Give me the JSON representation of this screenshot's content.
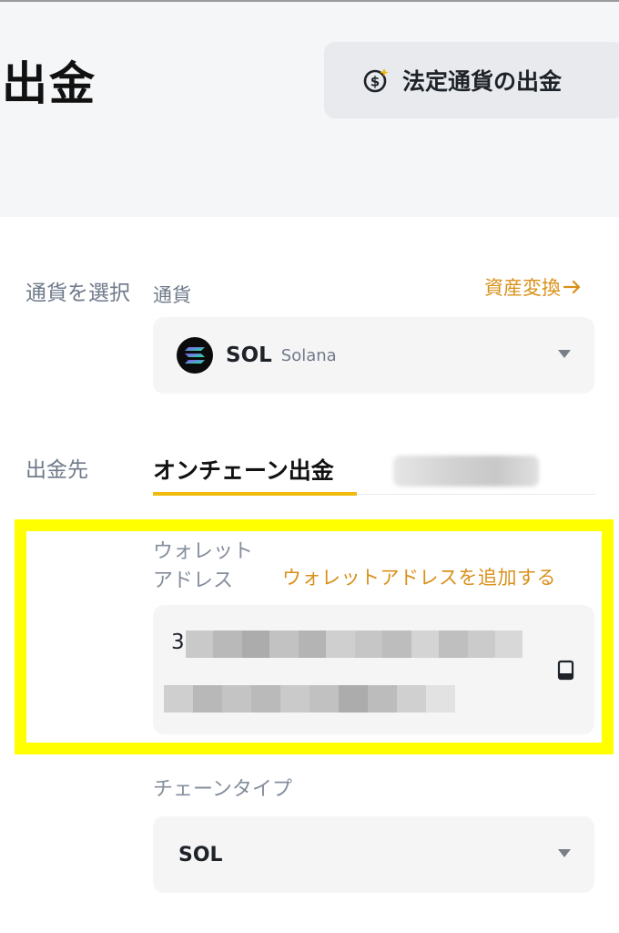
{
  "header": {
    "title": "出金",
    "fiat_button_label": "法定通貨の出金"
  },
  "currency_section": {
    "step_label": "通貨を選択",
    "field_label": "通貨",
    "asset_convert_link": "資産変換",
    "selected_symbol": "SOL",
    "selected_name": "Solana"
  },
  "destination_section": {
    "step_label": "出金先",
    "tabs": [
      {
        "label": "オンチェーン出金",
        "active": true
      },
      {
        "label": "",
        "active": false
      }
    ],
    "wallet_address_label": "ウォレットアドレス",
    "wallet_address_label_line1": "ウォレット",
    "wallet_address_label_line2": "アドレス",
    "add_address_link": "ウォレットアドレスを追加する",
    "address_visible_prefix": "3"
  },
  "chain_section": {
    "label": "チェーンタイプ",
    "selected": "SOL"
  },
  "icons": {
    "fiat": "dollar-coin-icon",
    "coin": "solana-logo-icon",
    "dropdown": "caret-down-icon",
    "address_book": "address-book-icon",
    "arrow": "arrow-right-icon"
  },
  "colors": {
    "accent": "#d9901a",
    "tab_underline": "#f0b90b",
    "highlight": "#ffff00"
  }
}
